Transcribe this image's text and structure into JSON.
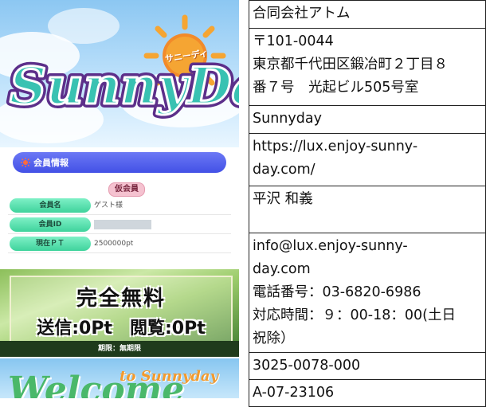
{
  "app": {
    "logo_text": "SunnyDay",
    "logo_badge": "サニーディ"
  },
  "member_info": {
    "header": "会員情報",
    "status_tag": "仮会員",
    "rows": [
      {
        "label": "会員名",
        "value": "ゲスト様"
      },
      {
        "label": "会員ID",
        "value": ""
      },
      {
        "label": "現在ＰＴ",
        "value": "2500000pt"
      }
    ]
  },
  "banner": {
    "title": "完全無料",
    "subtitle": "送信:0Pt　閲覧:0Pt",
    "footer": "期限：無期限"
  },
  "welcome": {
    "to_text": "to Sunnyday",
    "big_text": "Welcome"
  },
  "company_table": {
    "company_name": "合同会社アトム",
    "address_lines": [
      "〒101-0044",
      "東京都千代田区鍛冶町２丁目８",
      "番７号　光起ビル505号室"
    ],
    "site_name": "Sunnyday",
    "url_lines": [
      "https://lux.enjoy-sunny-",
      "day.com/"
    ],
    "representative": "平沢 和義",
    "contact_lines": [
      "info@lux.enjoy-sunny-",
      "day.com",
      "電話番号：03-6820-6986",
      "対応時間：９：00-18：00(土日",
      "祝除）"
    ],
    "license_number": "3025-0078-000",
    "registration_number": "A-07-23106"
  },
  "colors": {
    "header_blue": "#4f5cf0",
    "label_green": "#46d9a2",
    "tag_pink": "#f5c2d0",
    "logo_teal": "#2fb7a9",
    "logo_purple": "#5c2f8a",
    "sun_orange": "#f5a533"
  }
}
